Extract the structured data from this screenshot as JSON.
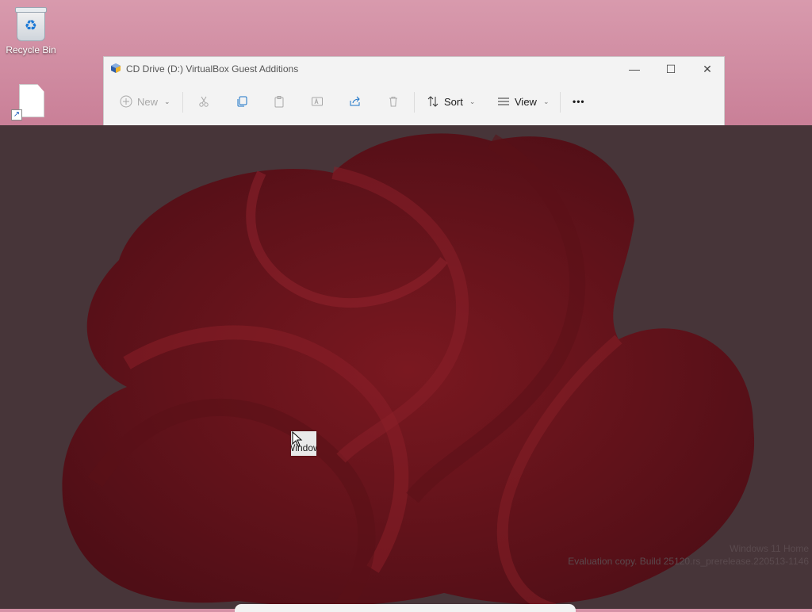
{
  "desktop": {
    "icons": [
      {
        "label": "Recycle Bin",
        "icon": "recycle-bin-icon"
      },
      {
        "label": "",
        "icon": "file-shortcut-icon"
      }
    ]
  },
  "explorer": {
    "title": "CD Drive (D:) VirtualBox Guest Additions",
    "toolbar": {
      "new_label": "New",
      "sort_label": "Sort",
      "view_label": "View",
      "more_label": "•••"
    },
    "window_controls": {
      "minimize": "—",
      "maximize": "☐",
      "close": "✕"
    }
  },
  "drag_ghost": {
    "text": "Window"
  },
  "watermark": {
    "line1": "Windows 11 Home",
    "line2": "Evaluation copy. Build 25120.rs_prerelease.220513-1146"
  },
  "colors": {
    "overlay": "#473539",
    "desktop_pink": "#d591a6",
    "bloom_red": "#6b141c"
  }
}
